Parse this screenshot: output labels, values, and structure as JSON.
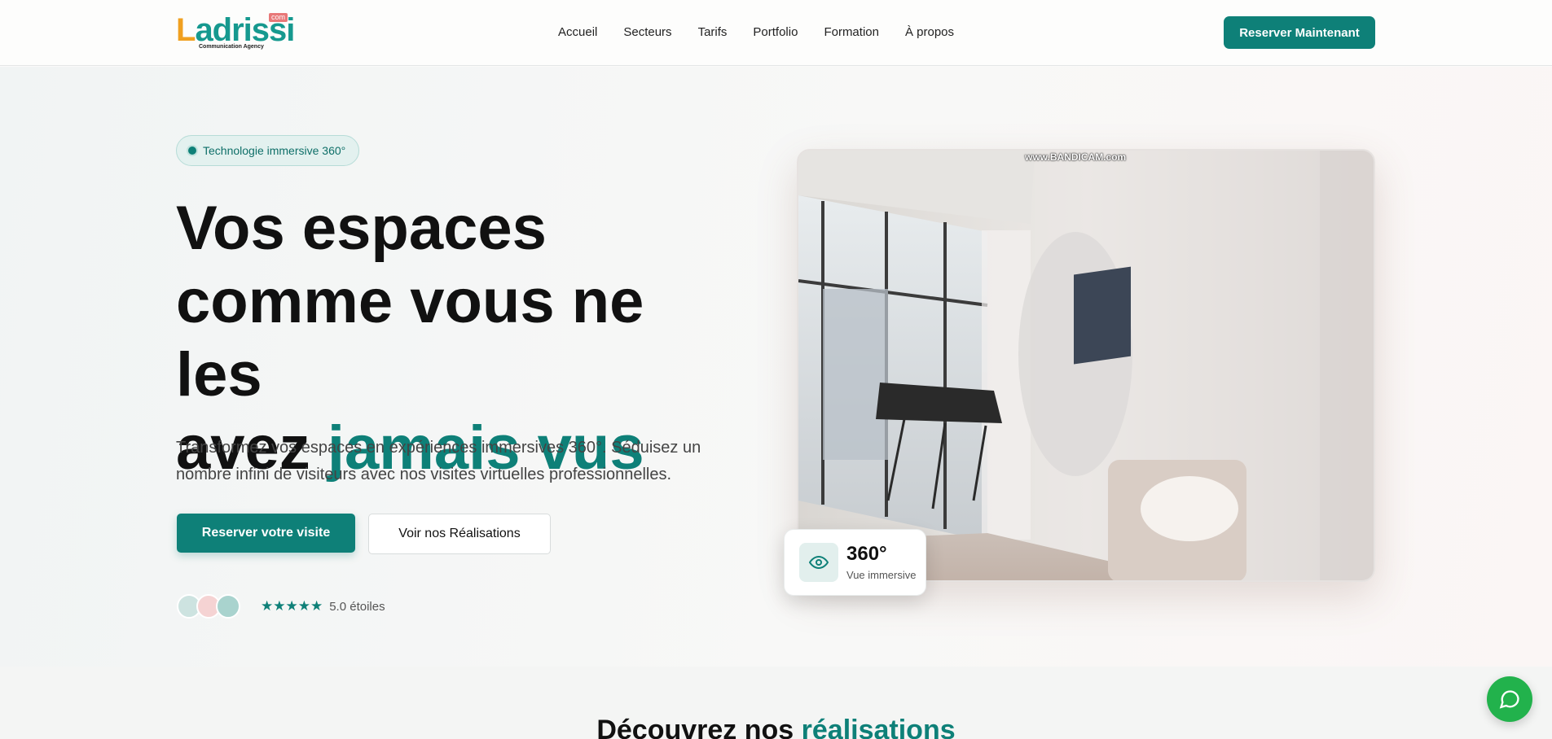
{
  "brand": {
    "logo_text": "Ladrissi",
    "logo_badge": "com",
    "logo_tagline": "Communication Agency"
  },
  "nav": {
    "items": [
      "Accueil",
      "Secteurs",
      "Tarifs",
      "Portfolio",
      "Formation",
      "À propos"
    ],
    "cta_label": "Reserver Maintenant"
  },
  "hero": {
    "badge": "Technologie immersive 360°",
    "headline_line1": "Vos espaces",
    "headline_line2": "comme vous ne les",
    "headline_line3_plain": "avez ",
    "headline_line3_accent": "jamais vus",
    "description": "Transformez vos espaces en expériences immersives 360°. Séduisez un nombre infini de visiteurs avec nos visites virtuelles professionnelles.",
    "primary_button": "Reserver votre visite",
    "secondary_button": "Voir nos Réalisations",
    "stars": "★★★★★",
    "rating_text": "5.0 étoiles",
    "media_watermark": "www.BANDICAM.com",
    "card_value": "360°",
    "card_label": "Vue immersive"
  },
  "section": {
    "title_plain": "Découvrez nos ",
    "title_accent": "réalisations"
  },
  "icons": {
    "card": "eye-icon",
    "chat": "chat-icon",
    "badge": "dot-icon"
  },
  "colors": {
    "accent": "#0e8078",
    "chat": "#22b24c"
  }
}
